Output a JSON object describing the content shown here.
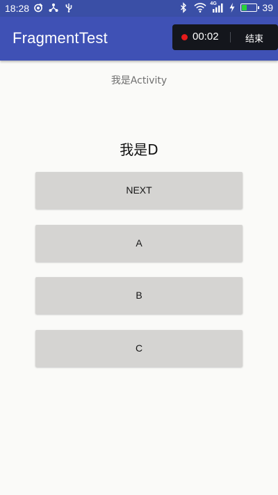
{
  "status_bar": {
    "time": "18:28",
    "battery_percent": "39",
    "battery_level": 0.39,
    "network_label": "4G",
    "icons_left": [
      "weibo-icon",
      "share-icon",
      "usb-icon"
    ],
    "icons_right": [
      "bluetooth-icon",
      "wifi-icon",
      "signal-icon",
      "charging-icon",
      "battery-icon"
    ]
  },
  "app_bar": {
    "title": "FragmentTest",
    "color": "#3f51b5"
  },
  "recorder": {
    "elapsed": "00:02",
    "end_label": "结束",
    "dot_color": "#e61b1b"
  },
  "main": {
    "activity_label": "我是Activity",
    "fragment_label": "我是D",
    "buttons": [
      {
        "label": "NEXT"
      },
      {
        "label": "A"
      },
      {
        "label": "B"
      },
      {
        "label": "C"
      }
    ]
  }
}
